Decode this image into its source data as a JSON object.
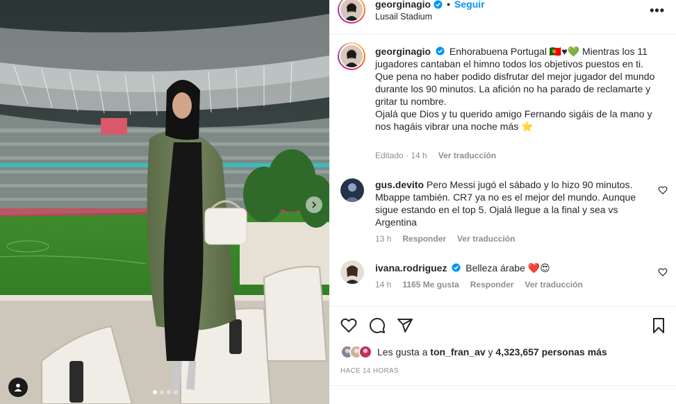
{
  "header": {
    "username": "georginagio",
    "follow_label": "Seguir",
    "separator": "•",
    "location": "Lusail Stadium",
    "more_label": "•••"
  },
  "caption": {
    "username": "georginagio",
    "text": "Enhorabuena Portugal 🇵🇹♥💚 Mientras los 11 jugadores cantaban el himno todos los objetivos puestos en ti.",
    "text2": "Que pena no haber podido disfrutar del mejor jugador del mundo durante los 90 minutos. La afición no ha parado de reclamarte y gritar tu nombre.",
    "text3": "Ojalá que Dios y tu querido amigo Fernando sigáis de la mano y nos hagáis vibrar una noche más ⭐",
    "edited": "Editado",
    "time": "14 h",
    "translate": "Ver traducción"
  },
  "comments": [
    {
      "username": "gus.devito",
      "text": "Pero Messi jugó el sábado y lo hizo 90 minutos. Mbappe también. CR7 ya no es el mejor del mundo. Aunque sigue estando en el top 5. Ojalá llegue a la final y sea vs Argentina",
      "time": "13 h",
      "reply": "Responder",
      "translate": "Ver traducción"
    },
    {
      "username": "ivana.rodriguez",
      "text": "Belleza árabe ❤️😍",
      "time": "14 h",
      "likes": "1165 Me gusta",
      "reply": "Responder",
      "translate": "Ver traducción"
    }
  ],
  "likes": {
    "prefix": "Les gusta a",
    "user": "ton_fran_av",
    "joiner": "y",
    "count": "4,323,657 personas más"
  },
  "timestamp": "HACE 14 HORAS",
  "carousel": {
    "total": 4,
    "active": 1
  },
  "colors": {
    "accent": "#0095f6",
    "muted": "#8e8e8e",
    "like_red": "#ed4956"
  },
  "icons": [
    "verified-icon",
    "more-icon",
    "heart-icon",
    "comment-icon",
    "share-icon",
    "bookmark-icon",
    "next-arrow-icon",
    "user-tag-icon"
  ]
}
